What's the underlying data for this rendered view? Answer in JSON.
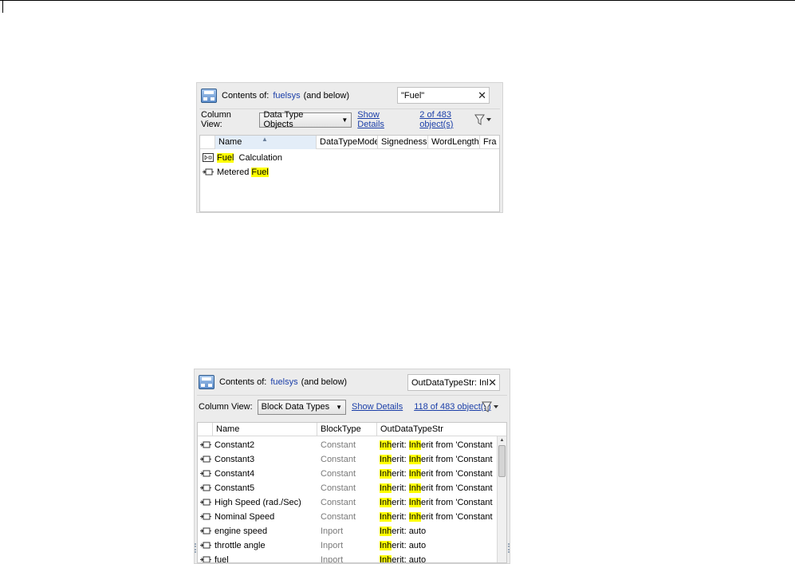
{
  "panel1": {
    "contents_label": "Contents of:",
    "model_name": "fuelsys",
    "scope_label": "(and below)",
    "search_value": "\"Fuel\"",
    "column_view_label": "Column View:",
    "column_view_selected": "Data Type Objects",
    "show_details_label": "Show Details",
    "object_count": "2 of 483 object(s)",
    "columns": [
      "Name",
      "DataTypeMode",
      "Signedness",
      "WordLength",
      "Fra"
    ],
    "rows": [
      {
        "icon": "subsystem-icon",
        "parts": [
          "Fuel",
          "Calculation"
        ]
      },
      {
        "icon": "signal-icon",
        "parts": [
          "Metered",
          "Fuel"
        ]
      }
    ]
  },
  "panel2": {
    "contents_label": "Contents of:",
    "model_name": "fuelsys",
    "scope_label": "(and below)",
    "search_value": "OutDataTypeStr: Inh",
    "column_view_label": "Column View:",
    "column_view_selected": "Block Data Types",
    "show_details_label": "Show Details",
    "object_count": "118 of 483 object(s)",
    "columns": [
      "Name",
      "BlockType",
      "OutDataTypeStr"
    ],
    "rows": [
      {
        "name": "Constant2",
        "blocktype": "Constant",
        "hl1": "Inh",
        "mid": "erit: ",
        "hl2": "Inh",
        "tail": "erit from 'Constant v"
      },
      {
        "name": "Constant3",
        "blocktype": "Constant",
        "hl1": "Inh",
        "mid": "erit: ",
        "hl2": "Inh",
        "tail": "erit from 'Constant v"
      },
      {
        "name": "Constant4",
        "blocktype": "Constant",
        "hl1": "Inh",
        "mid": "erit: ",
        "hl2": "Inh",
        "tail": "erit from 'Constant v"
      },
      {
        "name": "Constant5",
        "blocktype": "Constant",
        "hl1": "Inh",
        "mid": "erit: ",
        "hl2": "Inh",
        "tail": "erit from 'Constant v"
      },
      {
        "name": "High  Speed (rad./Sec)",
        "blocktype": "Constant",
        "hl1": "Inh",
        "mid": "erit: ",
        "hl2": "Inh",
        "tail": "erit from 'Constant v"
      },
      {
        "name": "Nominal Speed",
        "blocktype": "Constant",
        "hl1": "Inh",
        "mid": "erit: ",
        "hl2": "Inh",
        "tail": "erit from 'Constant v"
      },
      {
        "name": "engine speed",
        "blocktype": "Inport",
        "hl1": "Inh",
        "mid": "erit: auto",
        "hl2": "",
        "tail": ""
      },
      {
        "name": "throttle angle",
        "blocktype": "Inport",
        "hl1": "Inh",
        "mid": "erit: auto",
        "hl2": "",
        "tail": ""
      },
      {
        "name": "fuel",
        "blocktype": "Inport",
        "hl1": "Inh",
        "mid": "erit: auto",
        "hl2": "",
        "tail": ""
      }
    ]
  }
}
